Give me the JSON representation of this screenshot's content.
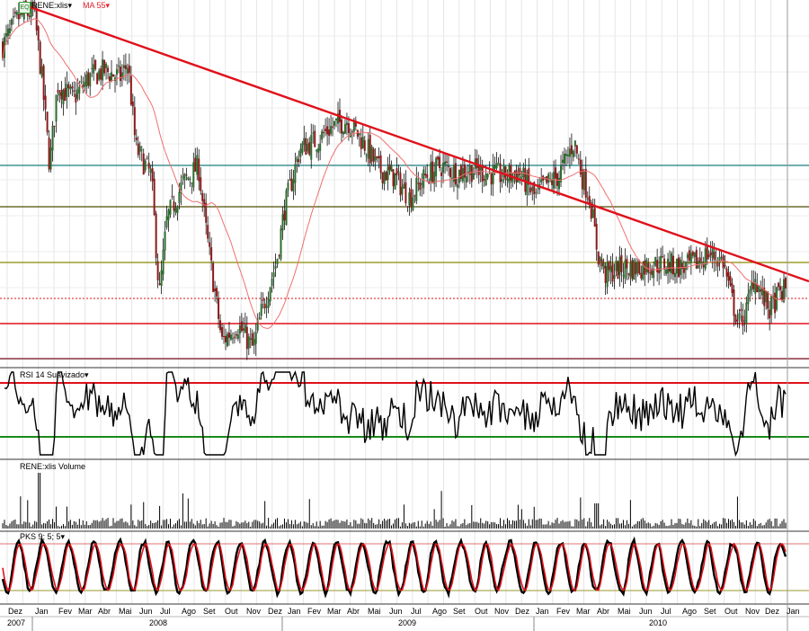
{
  "header": {
    "ticker_badge": "EQ",
    "ticker_label": "RENE:xlis",
    "ma_label": "MA 55",
    "ma_color": "#e0202a"
  },
  "panels": {
    "rsi_title": "RSI 14 Suavizado",
    "volume_title": "RENE:xlis Volume",
    "pks_title": "PKS 9; 5; 5"
  },
  "colors": {
    "up_candle": "#2e6b2e",
    "down_candle": "#8b1a1a",
    "trendline": "#e0101a",
    "rsi_line": "#000000",
    "pks_fast": "#000000",
    "pks_slow": "#e0101a",
    "level_teal": "#1a7f7f",
    "level_olive_dark": "#4d4d00",
    "level_olive": "#8a8a00",
    "level_red": "#e0101a",
    "level_maroon": "#7a1020"
  },
  "chart_data": {
    "type": "candlestick",
    "title": "",
    "x_axis": {
      "months": [
        "Dez",
        "Jan",
        "Fev",
        "Mar",
        "Abr",
        "Mai",
        "Jun",
        "Jul",
        "Ago",
        "Set",
        "Out",
        "Nov",
        "Dez",
        "Jan",
        "Fev",
        "Mar",
        "Abr",
        "Mai",
        "Jun",
        "Jul",
        "Ago",
        "Set",
        "Out",
        "Nov",
        "Dez",
        "Jan",
        "Fev",
        "Mar",
        "Abr",
        "Mai",
        "Jun",
        "Jul",
        "Ago",
        "Set",
        "Out",
        "Nov",
        "Dez",
        "Jan",
        "Fev",
        "Mar",
        "Abr",
        "Mai",
        "Jun",
        "Jul",
        "Ago",
        "Set",
        "Out",
        "Nov",
        "Dez",
        "Jan"
      ],
      "years": [
        "2007",
        "2008",
        "2009",
        "2010"
      ]
    },
    "price_series_shape": [
      [
        0,
        0.89
      ],
      [
        0.02,
        0.97
      ],
      [
        0.04,
        0.99
      ],
      [
        0.05,
        0.8
      ],
      [
        0.06,
        0.55
      ],
      [
        0.07,
        0.78
      ],
      [
        0.09,
        0.74
      ],
      [
        0.11,
        0.8
      ],
      [
        0.13,
        0.82
      ],
      [
        0.15,
        0.8
      ],
      [
        0.16,
        0.84
      ],
      [
        0.17,
        0.6
      ],
      [
        0.19,
        0.52
      ],
      [
        0.2,
        0.18
      ],
      [
        0.21,
        0.4
      ],
      [
        0.23,
        0.5
      ],
      [
        0.25,
        0.55
      ],
      [
        0.26,
        0.36
      ],
      [
        0.28,
        0.05
      ],
      [
        0.3,
        0.1
      ],
      [
        0.32,
        0.03
      ],
      [
        0.33,
        0.13
      ],
      [
        0.35,
        0.28
      ],
      [
        0.36,
        0.43
      ],
      [
        0.38,
        0.6
      ],
      [
        0.4,
        0.62
      ],
      [
        0.42,
        0.66
      ],
      [
        0.44,
        0.68
      ],
      [
        0.46,
        0.62
      ],
      [
        0.48,
        0.54
      ],
      [
        0.5,
        0.52
      ],
      [
        0.52,
        0.46
      ],
      [
        0.54,
        0.52
      ],
      [
        0.56,
        0.55
      ],
      [
        0.58,
        0.53
      ],
      [
        0.6,
        0.54
      ],
      [
        0.62,
        0.53
      ],
      [
        0.64,
        0.52
      ],
      [
        0.66,
        0.53
      ],
      [
        0.68,
        0.46
      ],
      [
        0.69,
        0.49
      ],
      [
        0.71,
        0.52
      ],
      [
        0.72,
        0.57
      ],
      [
        0.73,
        0.62
      ],
      [
        0.74,
        0.52
      ],
      [
        0.75,
        0.46
      ],
      [
        0.76,
        0.3
      ],
      [
        0.77,
        0.24
      ],
      [
        0.79,
        0.26
      ],
      [
        0.81,
        0.26
      ],
      [
        0.83,
        0.27
      ],
      [
        0.85,
        0.27
      ],
      [
        0.87,
        0.26
      ],
      [
        0.89,
        0.28
      ],
      [
        0.9,
        0.3
      ],
      [
        0.92,
        0.28
      ],
      [
        0.93,
        0.18
      ],
      [
        0.94,
        0.1
      ],
      [
        0.95,
        0.14
      ],
      [
        0.96,
        0.24
      ],
      [
        0.97,
        0.18
      ],
      [
        0.98,
        0.14
      ],
      [
        0.99,
        0.18
      ],
      [
        1.0,
        0.2
      ]
    ],
    "rsi_levels": [
      "upper",
      "lower"
    ],
    "trendline": "from 2007 high downward to right edge",
    "horizontal_levels": 6,
    "grid": true,
    "legend": "top-left"
  }
}
